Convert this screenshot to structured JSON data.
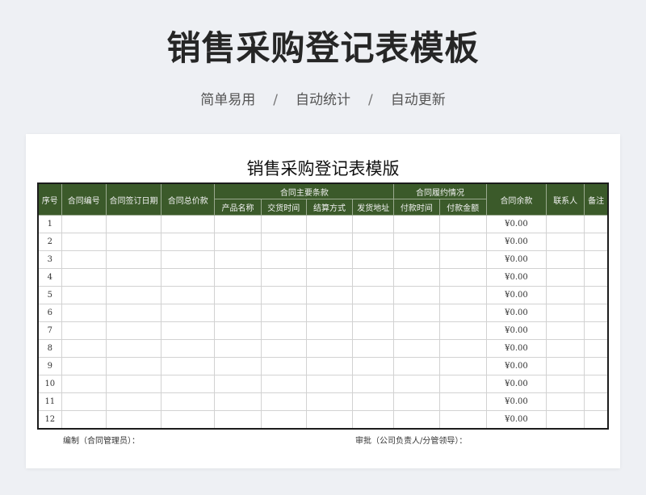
{
  "banner": {
    "title": "销售采购登记表模板",
    "tags": [
      "简单易用",
      "自动统计",
      "自动更新"
    ],
    "separator": "/"
  },
  "sheet": {
    "title": "销售采购登记表模版",
    "headers": {
      "seq": "序号",
      "contract_no": "合同编号",
      "sign_date": "合同签订日期",
      "total_price": "合同总价款",
      "main_terms": "合同主要条款",
      "product_name": "产品名称",
      "delivery_time": "交货时间",
      "settlement": "结算方式",
      "ship_address": "发货地址",
      "performance": "合同履约情况",
      "payment_time": "付款时间",
      "payment_amount": "付款金额",
      "balance": "合同余款",
      "contact": "联系人",
      "remark": "备注"
    },
    "rows": [
      {
        "seq": "1",
        "balance": "¥0.00"
      },
      {
        "seq": "2",
        "balance": "¥0.00"
      },
      {
        "seq": "3",
        "balance": "¥0.00"
      },
      {
        "seq": "4",
        "balance": "¥0.00"
      },
      {
        "seq": "5",
        "balance": "¥0.00"
      },
      {
        "seq": "6",
        "balance": "¥0.00"
      },
      {
        "seq": "7",
        "balance": "¥0.00"
      },
      {
        "seq": "8",
        "balance": "¥0.00"
      },
      {
        "seq": "9",
        "balance": "¥0.00"
      },
      {
        "seq": "10",
        "balance": "¥0.00"
      },
      {
        "seq": "11",
        "balance": "¥0.00"
      },
      {
        "seq": "12",
        "balance": "¥0.00"
      }
    ],
    "footer": {
      "prepared_by": "编制（合同管理员）：",
      "approved_by": "审批（公司负责人/分管领导）："
    }
  }
}
